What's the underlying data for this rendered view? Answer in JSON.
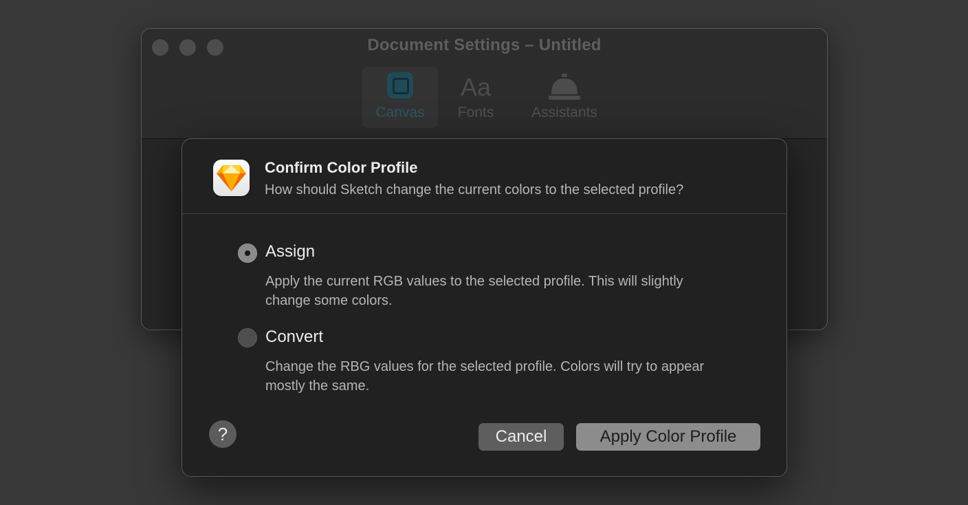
{
  "background_window": {
    "title": "Document Settings – Untitled",
    "tabs": [
      {
        "label": "Canvas",
        "icon": "canvas-icon",
        "active": true
      },
      {
        "label": "Fonts",
        "icon": "fonts-icon",
        "glyph": "Aa",
        "active": false
      },
      {
        "label": "Assistants",
        "icon": "bell-icon",
        "active": false
      }
    ]
  },
  "dialog": {
    "app_icon": "sketch-app-icon",
    "title": "Confirm Color Profile",
    "subtitle": "How should Sketch change the current colors to the selected profile?",
    "options": [
      {
        "label": "Assign",
        "description": "Apply the current RGB values to the selected profile. This will slightly change some colors.",
        "selected": true
      },
      {
        "label": "Convert",
        "description": "Change the RBG values for the selected profile. Colors will try to appear mostly the same.",
        "selected": false
      }
    ],
    "help_label": "?",
    "cancel_label": "Cancel",
    "apply_label": "Apply Color Profile"
  },
  "colors": {
    "desktop": "#383838",
    "dialog_bg": "#212121",
    "primary_button": "#8c8c8c",
    "secondary_button": "#5e5e5e",
    "canvas_accent": "#1f4b59"
  }
}
